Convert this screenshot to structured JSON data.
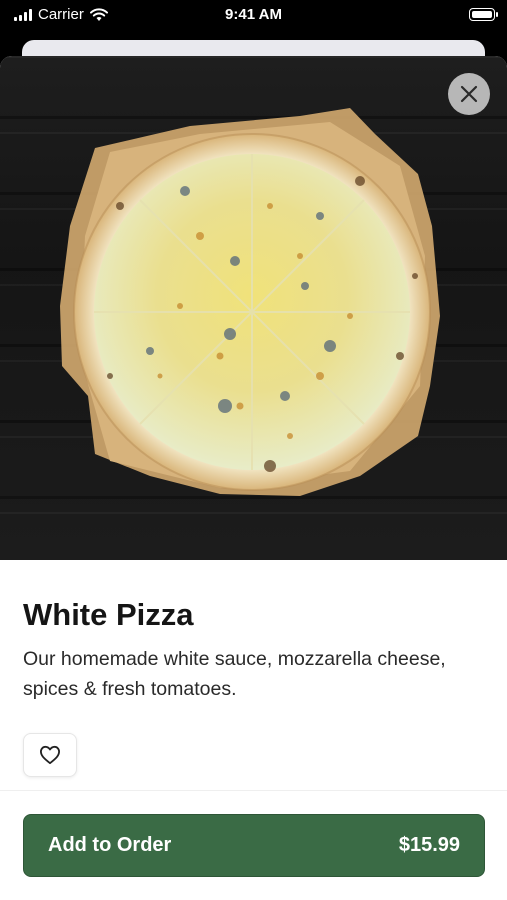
{
  "status_bar": {
    "carrier": "Carrier",
    "time": "9:41 AM"
  },
  "item": {
    "name": "White Pizza",
    "description": "Our homemade white sauce, mozzarella cheese, spices & fresh tomatoes."
  },
  "actions": {
    "add_label": "Add to Order",
    "price": "$15.99"
  },
  "icons": {
    "close": "close-icon",
    "favorite": "heart-outline-icon"
  },
  "colors": {
    "primary_button": "#3a6b45"
  }
}
